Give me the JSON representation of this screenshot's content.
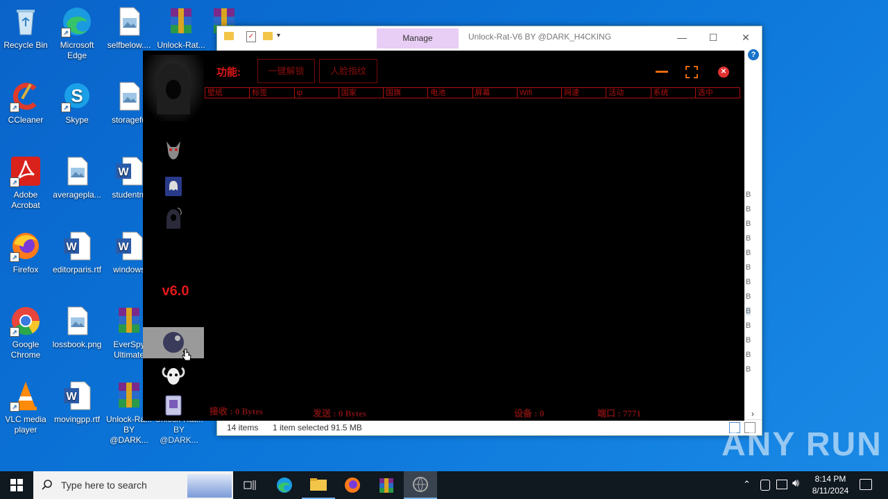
{
  "desktop_icons": [
    {
      "label": "Recycle Bin"
    },
    {
      "label": "Microsoft Edge"
    },
    {
      "label": "selfbelow...."
    },
    {
      "label": "Unlock-Rat..."
    },
    {
      "label": "U"
    },
    {
      "label": "CCleaner"
    },
    {
      "label": "Skype"
    },
    {
      "label": "storagefu"
    },
    {
      "label": "Adobe Acrobat"
    },
    {
      "label": "averagepla..."
    },
    {
      "label": "studentm"
    },
    {
      "label": "Firefox"
    },
    {
      "label": "editorparis.rtf"
    },
    {
      "label": "windows"
    },
    {
      "label": "Google Chrome"
    },
    {
      "label": "lossbook.png"
    },
    {
      "label": "EverSpy Ultimate"
    },
    {
      "label": "VLC media player"
    },
    {
      "label": "movingpp.rtf"
    },
    {
      "label": "Unlock-Ra... BY @DARK..."
    },
    {
      "label": "Unlock-Rat... BY @DARK..."
    }
  ],
  "explorer": {
    "manage_tab": "Manage",
    "title": "Unlock-Rat-V6 BY @DARK_H4CKING",
    "status_items": "14 items",
    "status_selected": "1 item selected  91.5 MB",
    "size_suffix": "B"
  },
  "rat": {
    "function_label": "功能:",
    "btn_unlock": "一键解锁",
    "btn_face": "人脸指纹",
    "version": "v6.0",
    "columns": [
      "壁纸",
      "标签",
      "ip",
      "国家",
      "国旗",
      "电池",
      "屏幕",
      "Wifi",
      "网速",
      "活动",
      "系统",
      "选中"
    ],
    "recv": "接收 : 0 Bytes",
    "send": "发送 : 0 Bytes",
    "devices": "设备 : 0",
    "port": "端口 : 7771"
  },
  "taskbar": {
    "search_placeholder": "Type here to search",
    "time": "8:14 PM",
    "date": "8/11/2024"
  },
  "watermark": "ANY RUN"
}
